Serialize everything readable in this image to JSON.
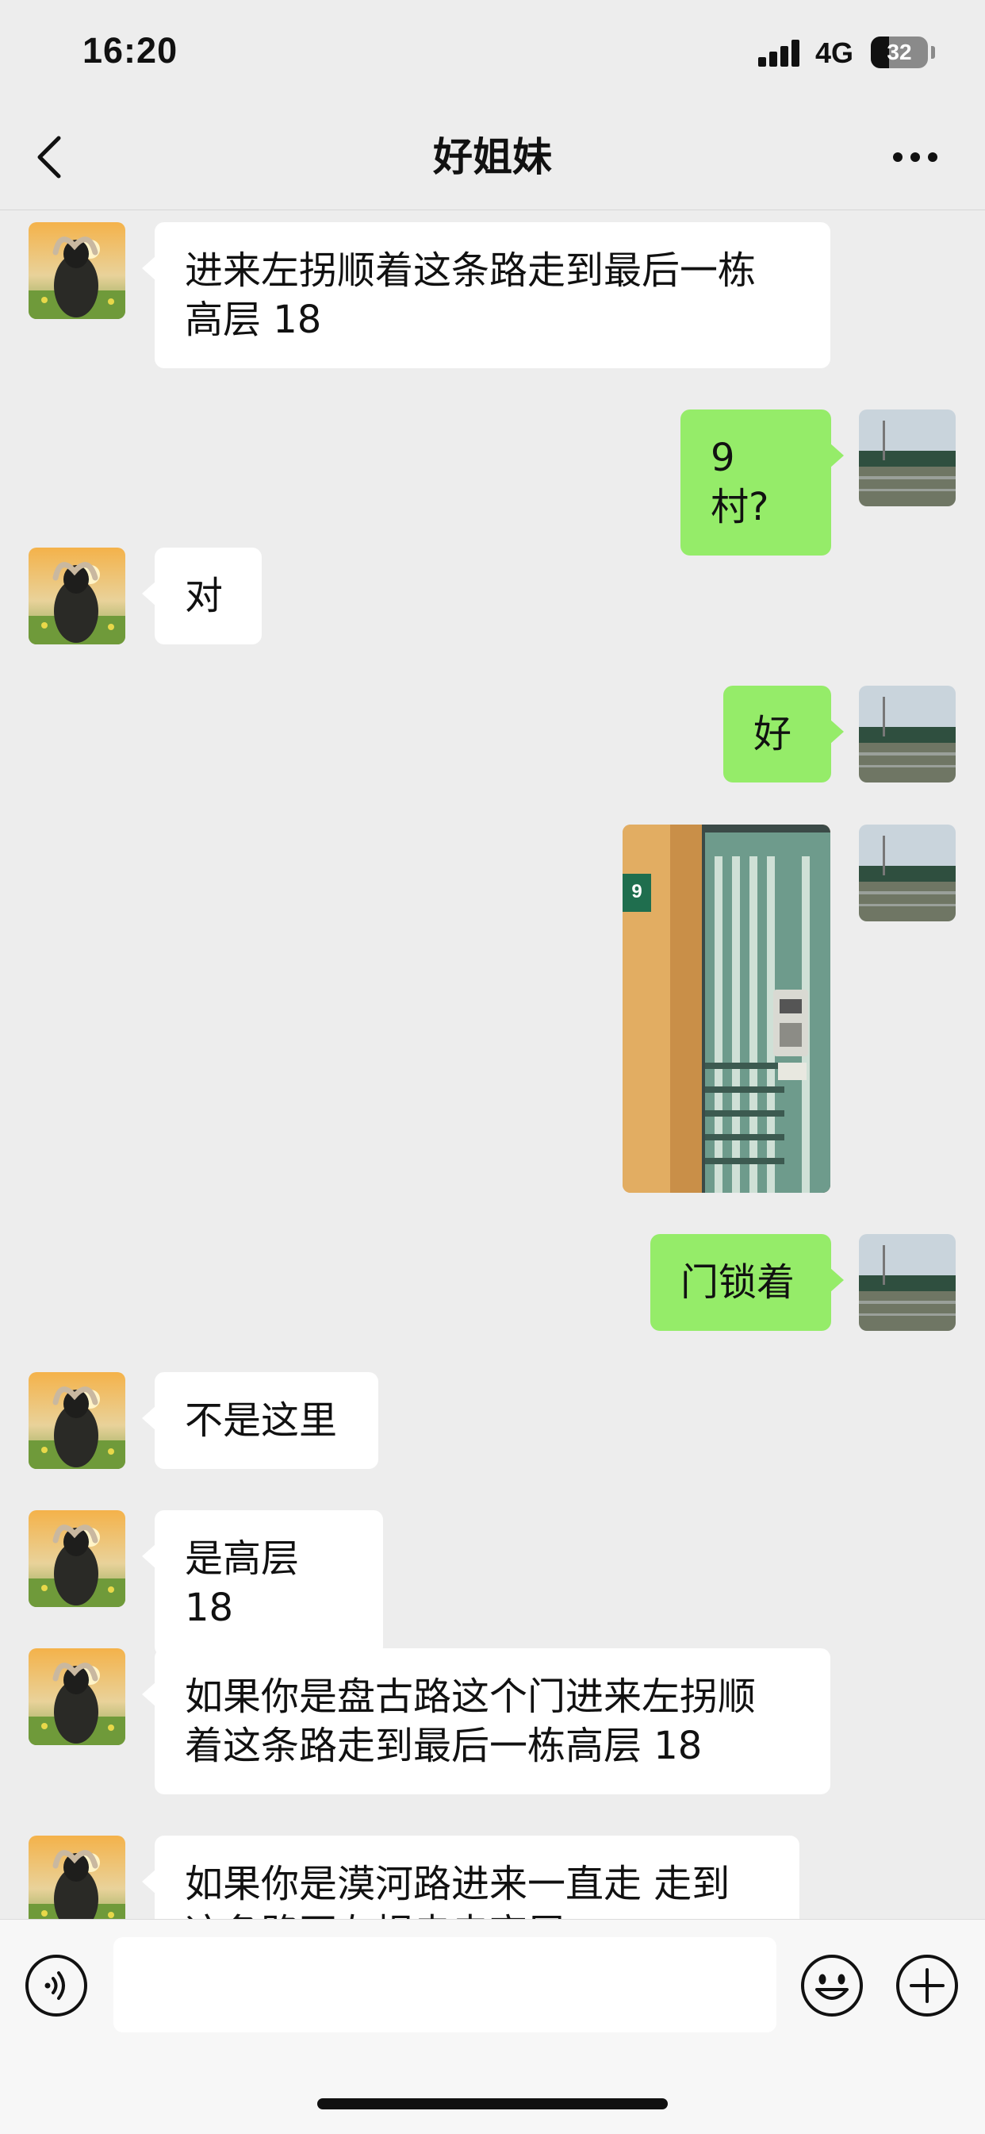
{
  "status_bar": {
    "time": "16:20",
    "network": "4G",
    "battery": "32",
    "battery_level": 0.32
  },
  "nav": {
    "title": "好姐妹",
    "back_icon": "chevron-left-icon",
    "more_icon": "more-dots-icon"
  },
  "messages": [
    {
      "side": "incoming",
      "text": "进来左拐顺着这条路走到最后一栋\n高层 18"
    },
    {
      "side": "outgoing",
      "text": "9 村?"
    },
    {
      "side": "incoming",
      "text": "对"
    },
    {
      "side": "outgoing",
      "text": "好"
    },
    {
      "side": "outgoing",
      "type": "image",
      "text": "9"
    },
    {
      "side": "outgoing",
      "text": "门锁着"
    },
    {
      "side": "incoming",
      "text": "不是这里"
    },
    {
      "side": "incoming",
      "text": "是高层 18"
    },
    {
      "side": "incoming",
      "text": "如果你是盘古路这个门进来左拐顺\n着这条路走到最后一栋高层 18"
    },
    {
      "side": "incoming",
      "text": "如果你是漠河路进来一直走 走到\n这条路再左拐走走高层"
    }
  ],
  "input": {
    "placeholder": "",
    "value": "",
    "voice_icon": "voice-icon",
    "emoji_icon": "emoji-icon",
    "plus_icon": "plus-icon"
  },
  "colors": {
    "background": "#ededed",
    "incoming_bubble": "#ffffff",
    "outgoing_bubble": "#95ec69"
  }
}
